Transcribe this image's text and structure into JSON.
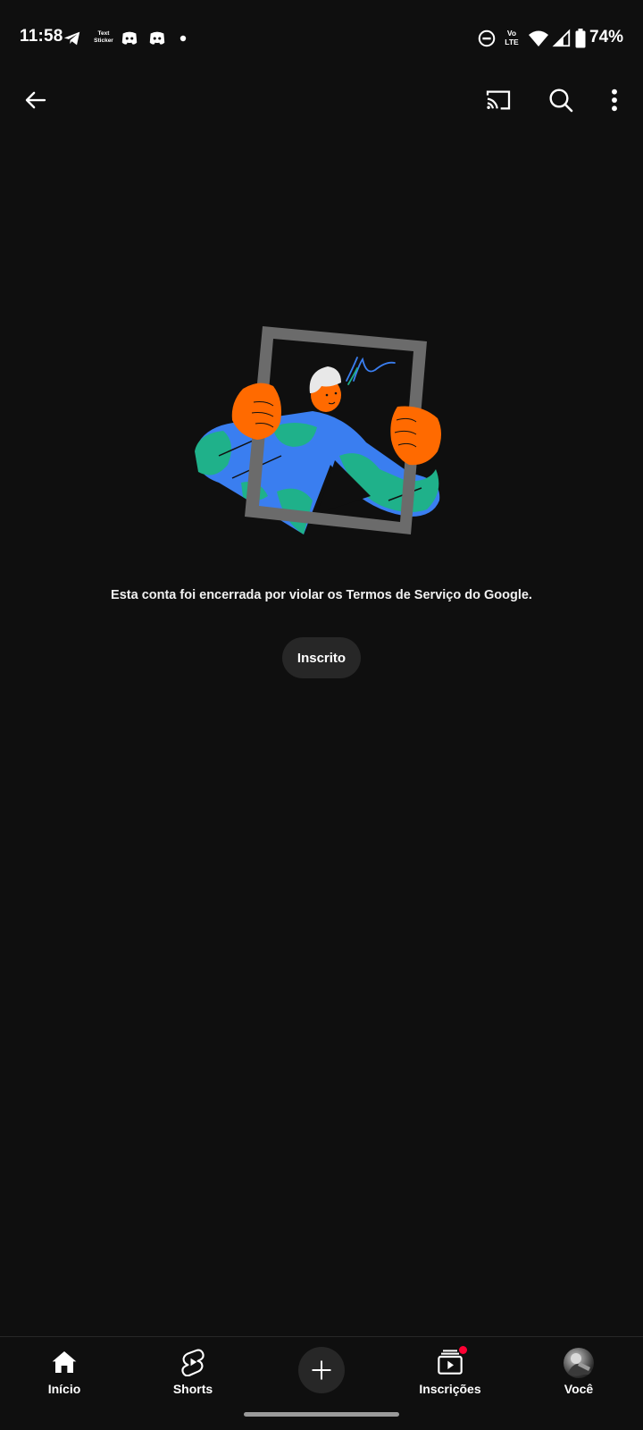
{
  "status_bar": {
    "time": "11:58",
    "sticker_line1": "Text",
    "sticker_line2": "Sticker",
    "network_line1": "Vo",
    "network_line2": "LTE",
    "battery": "74%",
    "icons": [
      "telegram-icon",
      "text-sticker-icon",
      "discord-icon",
      "discord-icon",
      "dot-icon",
      "do-not-disturb-icon",
      "volte-icon",
      "wifi-icon",
      "signal-icon",
      "battery-icon"
    ]
  },
  "top_bar": {
    "icons": [
      "back-arrow-icon",
      "cast-icon",
      "search-icon",
      "more-vert-icon"
    ]
  },
  "main": {
    "message": "Esta conta foi encerrada por violar os Termos de Serviço do Google.",
    "subscribed_label": "Inscrito"
  },
  "bottom_nav": {
    "items": [
      {
        "label": "Início",
        "icon": "home-icon"
      },
      {
        "label": "Shorts",
        "icon": "shorts-icon"
      },
      {
        "label": "",
        "icon": "plus-icon"
      },
      {
        "label": "Inscrições",
        "icon": "subscriptions-icon"
      },
      {
        "label": "Você",
        "icon": "avatar"
      }
    ]
  },
  "colors": {
    "background": "#0f0f0f",
    "button_bg": "#272727",
    "notification_dot": "#ff0033",
    "illustration_orange": "#ff6a00",
    "illustration_blue": "#3a7ef0",
    "illustration_teal": "#1fb18a",
    "frame_gray": "#6b6b6b"
  }
}
